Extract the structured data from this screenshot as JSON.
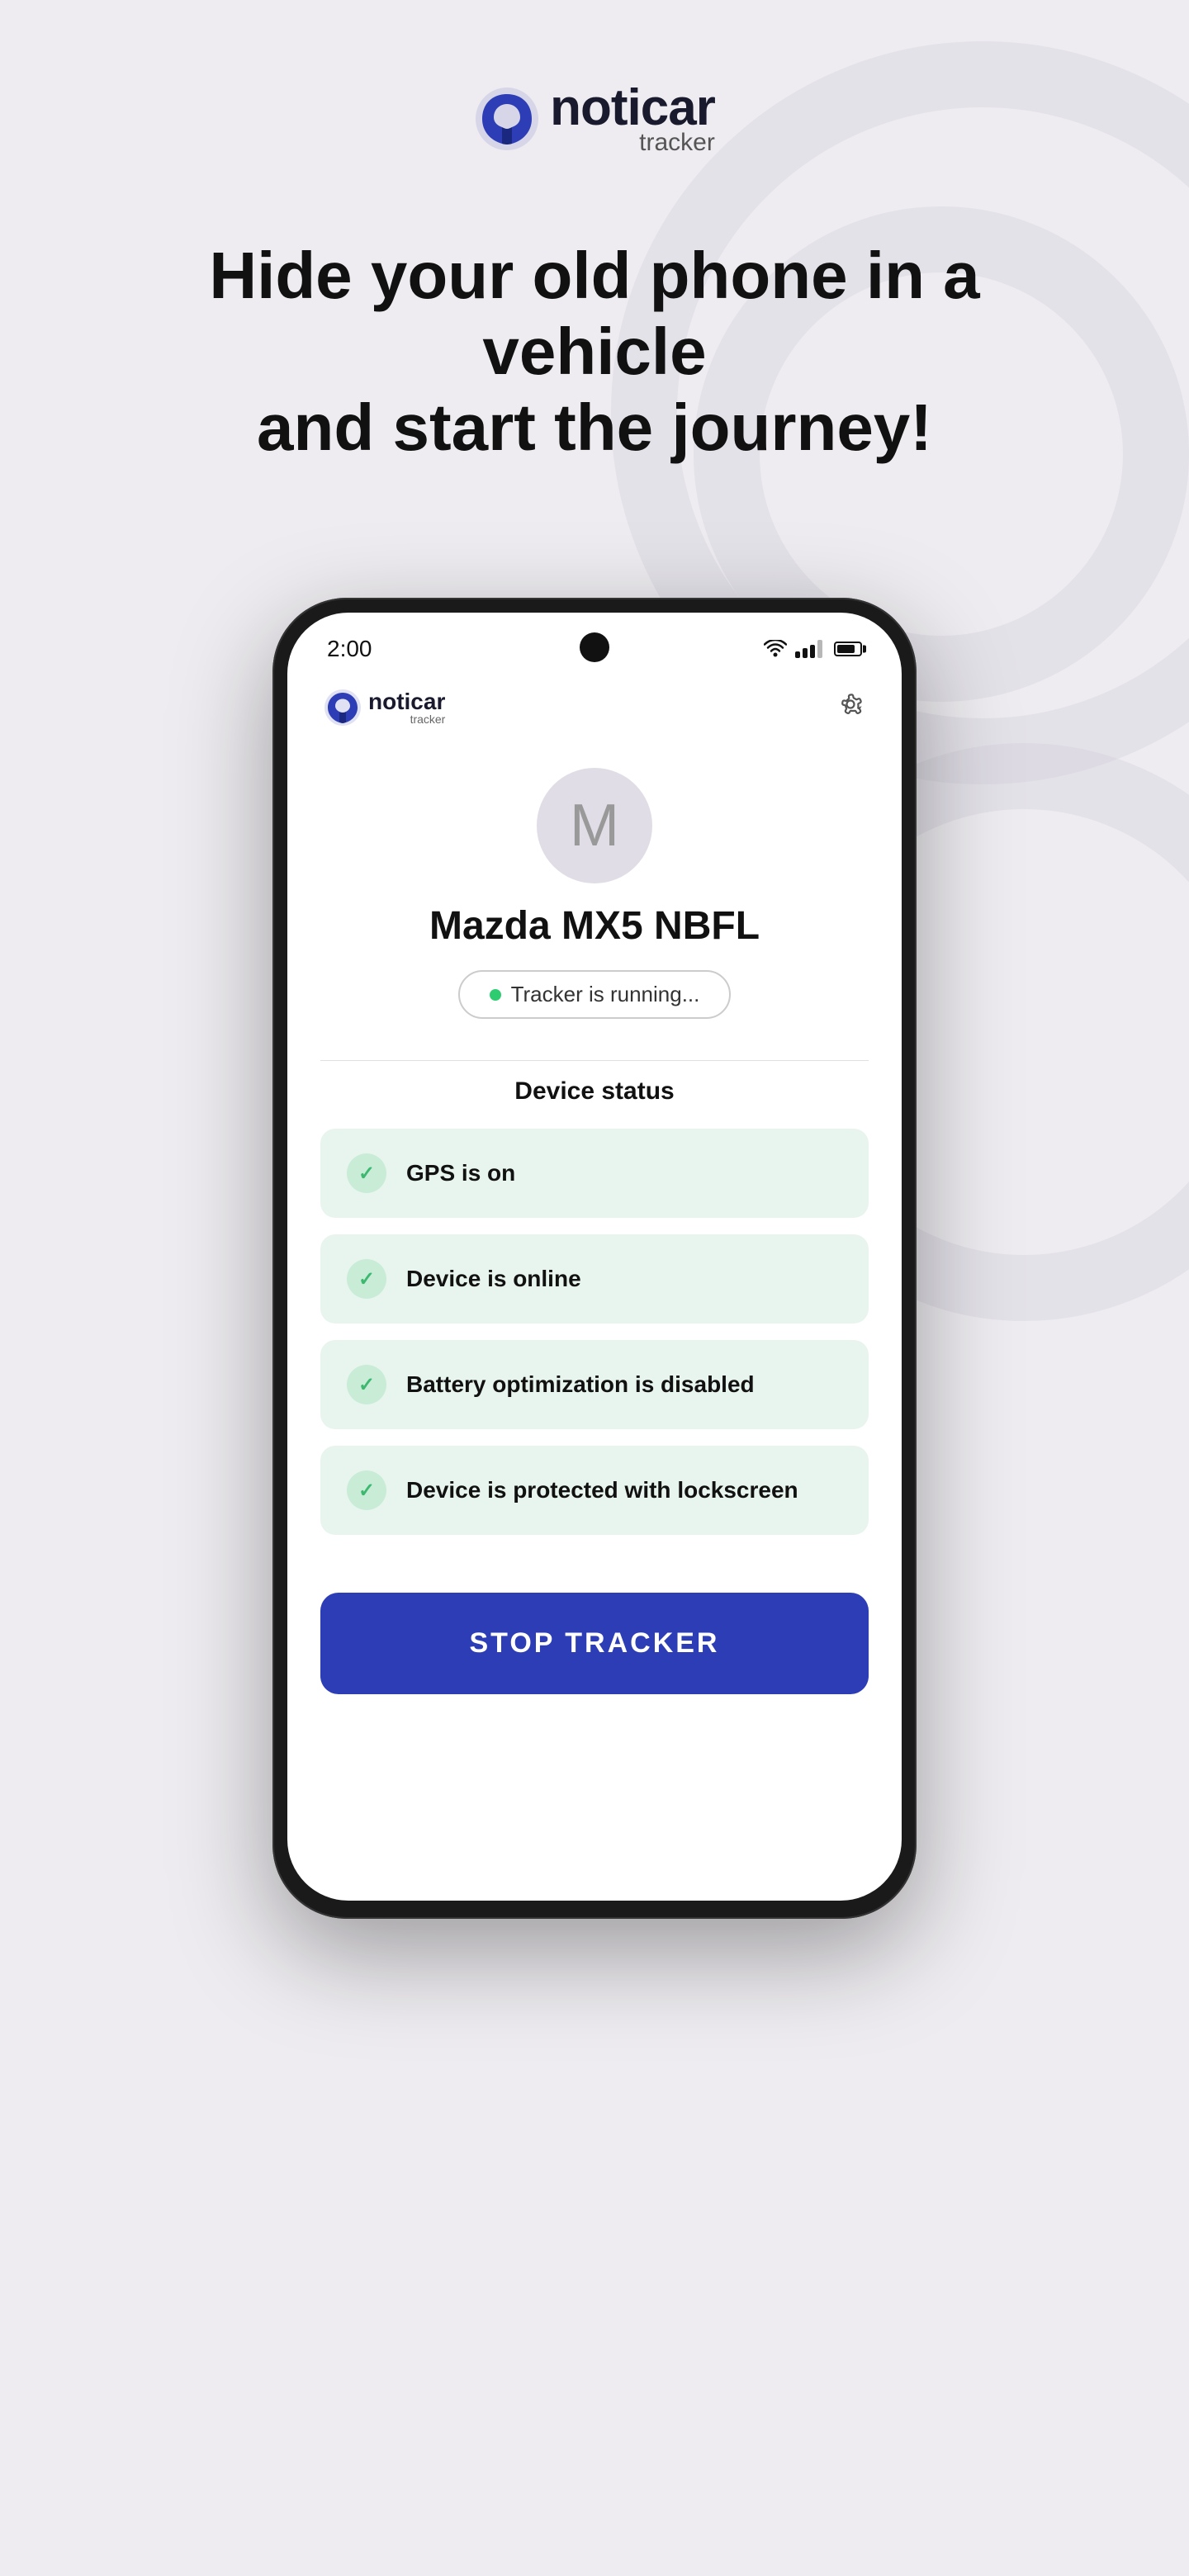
{
  "page": {
    "background_color": "#eeecf0"
  },
  "top_logo": {
    "noticar": "noticar",
    "tracker": "tracker"
  },
  "hero": {
    "line1": "Hide your old phone in a vehicle",
    "line2": "and start the journey!"
  },
  "phone": {
    "status_bar": {
      "time": "2:00"
    },
    "app_header": {
      "logo_noticar": "noticar",
      "logo_tracker": "tracker"
    },
    "vehicle": {
      "avatar_letter": "M",
      "name": "Mazda MX5 NBFL",
      "tracker_status": "Tracker is running..."
    },
    "device_status": {
      "title": "Device status",
      "items": [
        {
          "label": "GPS is on"
        },
        {
          "label": "Device is online"
        },
        {
          "label": "Battery optimization is disabled"
        },
        {
          "label": "Device is protected with lockscreen"
        }
      ]
    },
    "stop_button": {
      "label": "STOP TRACKER"
    }
  }
}
